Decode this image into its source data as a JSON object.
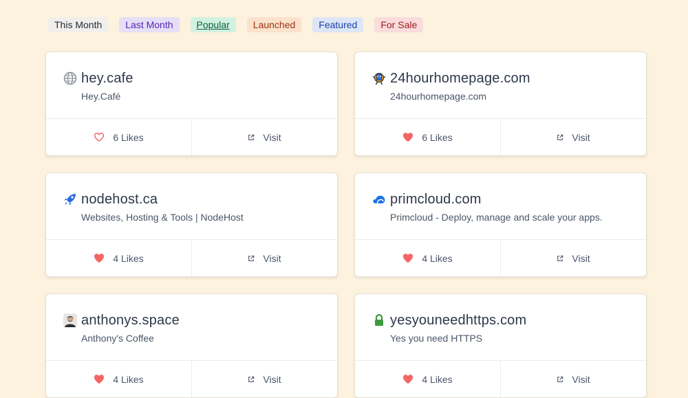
{
  "filters": [
    {
      "label": "This Month",
      "bg": "#f1efeb",
      "fg": "#1f2937",
      "active": false
    },
    {
      "label": "Last Month",
      "bg": "#e5dff7",
      "fg": "#5b21b6",
      "active": false
    },
    {
      "label": "Popular",
      "bg": "#d3f1e0",
      "fg": "#065f46",
      "active": true
    },
    {
      "label": "Launched",
      "bg": "#fbe2cc",
      "fg": "#9a3412",
      "active": false
    },
    {
      "label": "Featured",
      "bg": "#dde6f6",
      "fg": "#1e40af",
      "active": false
    },
    {
      "label": "For Sale",
      "bg": "#fadcdc",
      "fg": "#991b1b",
      "active": false
    }
  ],
  "cards": [
    {
      "title": "hey.cafe",
      "description": "Hey.Café",
      "likes": "6 Likes",
      "liked": false,
      "visit": "Visit",
      "favicon": "globe-icon"
    },
    {
      "title": "24hourhomepage.com",
      "description": "24hourhomepage.com",
      "likes": "6 Likes",
      "liked": true,
      "visit": "Visit",
      "favicon": "clock-character-icon"
    },
    {
      "title": "nodehost.ca",
      "description": "Websites, Hosting & Tools | NodeHost",
      "likes": "4 Likes",
      "liked": true,
      "visit": "Visit",
      "favicon": "rocket-icon"
    },
    {
      "title": "primcloud.com",
      "description": "Primcloud - Deploy, manage and scale your apps.",
      "likes": "4 Likes",
      "liked": true,
      "visit": "Visit",
      "favicon": "cloud-icon"
    },
    {
      "title": "anthonys.space",
      "description": "Anthony's Coffee",
      "likes": "4 Likes",
      "liked": true,
      "visit": "Visit",
      "favicon": "avatar-icon"
    },
    {
      "title": "yesyouneedhttps.com",
      "description": "Yes you need HTTPS",
      "likes": "4 Likes",
      "liked": true,
      "visit": "Visit",
      "favicon": "lock-icon"
    }
  ],
  "colors": {
    "background": "#fcf2de",
    "heart": "#f56565"
  }
}
